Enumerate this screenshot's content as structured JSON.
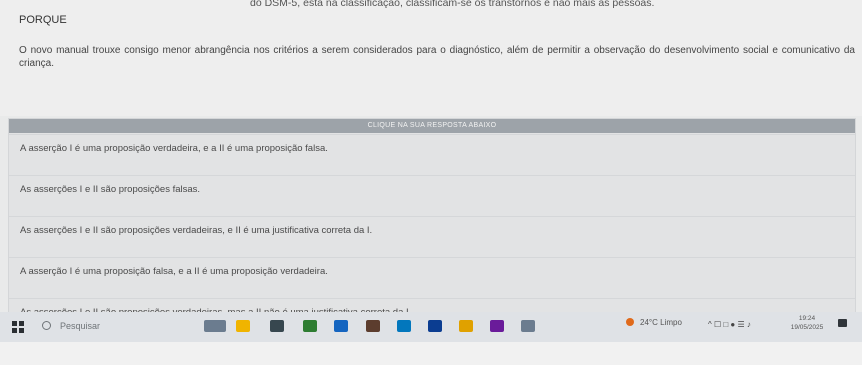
{
  "question": {
    "top_text": "do DSM-5, esta na classificação, classificam-se os transtornos e não mais as pessoas.",
    "porque": "PORQUE",
    "body": "O novo manual trouxe consigo menor abrangência nos critérios a serem considerados para o diagnóstico, além de permitir a observação do desenvolvimento social e comunicativo da criança."
  },
  "answers": {
    "header": "CLIQUE NA SUA RESPOSTA ABAIXO",
    "options": [
      "A asserção I é uma proposição verdadeira, e a II é uma proposição falsa.",
      "As asserções I e II são proposições falsas.",
      "As asserções I e II são proposições verdadeiras, e II é uma justificativa correta da I.",
      "A asserção I é uma proposição falsa, e a II é uma proposição verdadeira.",
      "As asserções I e II são proposições verdadeiras, mas a II não é uma justificativa correta da I."
    ]
  },
  "taskbar": {
    "search_label": "Pesquisar",
    "weather": "24°C  Limpo",
    "time": "19:24",
    "date": "19/05/2025",
    "colors": {
      "start": "#2b2f33",
      "apps": [
        "#6b7c8f",
        "#f0b400",
        "#37474f",
        "#2e7d32",
        "#1565c0",
        "#5c3d2e",
        "#0277bd",
        "#0b3d91",
        "#e0a100",
        "#6a1b9a"
      ]
    }
  }
}
